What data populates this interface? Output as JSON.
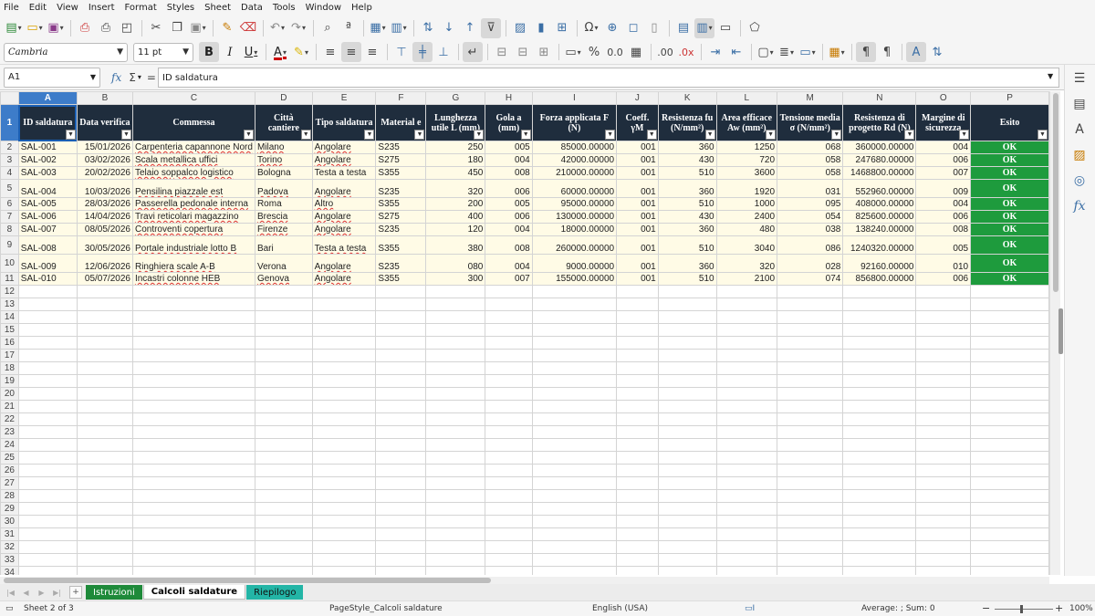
{
  "menu": [
    "File",
    "Edit",
    "View",
    "Insert",
    "Format",
    "Styles",
    "Sheet",
    "Data",
    "Tools",
    "Window",
    "Help"
  ],
  "toolbar": {
    "font_name": "Cambria",
    "font_size": "11 pt"
  },
  "formula_bar": {
    "cell_ref": "A1",
    "content": "ID saldatura"
  },
  "columns": [
    "A",
    "B",
    "C",
    "D",
    "E",
    "F",
    "G",
    "H",
    "I",
    "J",
    "K",
    "L",
    "M",
    "N",
    "O",
    "P"
  ],
  "header_row": [
    "ID saldatura",
    "Data verifica",
    "Commessa",
    "Città cantiere",
    "Tipo saldatura",
    "Material e",
    "Lunghezza utile L (mm)",
    "Gola a (mm)",
    "Forza applicata F (N)",
    "Coeff. γM",
    "Resistenza fu (N/mm²)",
    "Area efficace Aw (mm²)",
    "Tensione media σ (N/mm²)",
    "Resistenza di progetto Rd (N)",
    "Margine di sicurezza",
    "Esito"
  ],
  "rows": [
    [
      "SAL-001",
      "15/01/2026",
      "Carpenteria capannone Nord",
      "Milano",
      "Angolare",
      "S235",
      "250",
      "005",
      "85000.00000",
      "001",
      "360",
      "1250",
      "068",
      "360000.00000",
      "004",
      "OK"
    ],
    [
      "SAL-002",
      "03/02/2026",
      "Scala metallica uffici",
      "Torino",
      "Angolare",
      "S275",
      "180",
      "004",
      "42000.00000",
      "001",
      "430",
      "720",
      "058",
      "247680.00000",
      "006",
      "OK"
    ],
    [
      "SAL-003",
      "20/02/2026",
      "Telaio soppalco logistico",
      "Bologna",
      "Testa a testa",
      "S355",
      "450",
      "008",
      "210000.00000",
      "001",
      "510",
      "3600",
      "058",
      "1468800.00000",
      "007",
      "OK"
    ],
    [
      "SAL-004",
      "10/03/2026",
      "Pensilina piazzale est",
      "Padova",
      "Angolare",
      "S235",
      "320",
      "006",
      "60000.00000",
      "001",
      "360",
      "1920",
      "031",
      "552960.00000",
      "009",
      "OK"
    ],
    [
      "SAL-005",
      "28/03/2026",
      "Passerella pedonale interna",
      "Roma",
      "Altro",
      "S355",
      "200",
      "005",
      "95000.00000",
      "001",
      "510",
      "1000",
      "095",
      "408000.00000",
      "004",
      "OK"
    ],
    [
      "SAL-006",
      "14/04/2026",
      "Travi reticolari magazzino",
      "Brescia",
      "Angolare",
      "S275",
      "400",
      "006",
      "130000.00000",
      "001",
      "430",
      "2400",
      "054",
      "825600.00000",
      "006",
      "OK"
    ],
    [
      "SAL-007",
      "08/05/2026",
      "Controventi copertura",
      "Firenze",
      "Angolare",
      "S235",
      "120",
      "004",
      "18000.00000",
      "001",
      "360",
      "480",
      "038",
      "138240.00000",
      "008",
      "OK"
    ],
    [
      "SAL-008",
      "30/05/2026",
      "Portale industriale lotto B",
      "Bari",
      "Testa a testa",
      "S355",
      "380",
      "008",
      "260000.00000",
      "001",
      "510",
      "3040",
      "086",
      "1240320.00000",
      "005",
      "OK"
    ],
    [
      "SAL-009",
      "12/06/2026",
      "Ringhiera scale A-B",
      "Verona",
      "Angolare",
      "S235",
      "080",
      "004",
      "9000.00000",
      "001",
      "360",
      "320",
      "028",
      "92160.00000",
      "010",
      "OK"
    ],
    [
      "SAL-010",
      "05/07/2026",
      "Incastri colonne HEB",
      "Genova",
      "Angolare",
      "S355",
      "300",
      "007",
      "155000.00000",
      "001",
      "510",
      "2100",
      "074",
      "856800.00000",
      "006",
      "OK"
    ]
  ],
  "sheet_tabs": [
    "Istruzioni",
    "Calcoli saldature",
    "Riepilogo"
  ],
  "status": {
    "sheet": "Sheet 2 of 3",
    "page_style": "PageStyle_Calcoli saldature",
    "language": "English (USA)",
    "summary": "Average: ; Sum: 0",
    "zoom": "100%"
  },
  "colors": {
    "header_bg": "#1f2d3d",
    "ok_bg": "#1e9b3d",
    "data_bg": "#fffbe6",
    "tab_istruzioni": "#1e8a3a",
    "tab_riepilogo": "#23b5a6"
  }
}
